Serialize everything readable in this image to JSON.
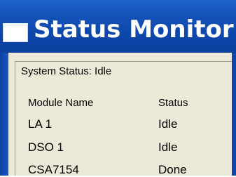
{
  "window": {
    "title": "Status Monitor",
    "icon": "window-icon"
  },
  "system": {
    "status_label": "System Status:",
    "status_value": "Idle"
  },
  "table": {
    "headers": [
      "Module Name",
      "Status"
    ],
    "rows": [
      {
        "name": "LA 1",
        "status": "Idle"
      },
      {
        "name": "DSO 1",
        "status": "Idle"
      },
      {
        "name": "CSA7154",
        "status": "Done"
      }
    ]
  },
  "colors": {
    "titlebar": "#0d47ab",
    "title_text": "#ffffff",
    "panel": "#ece9d8",
    "text": "#000000"
  }
}
